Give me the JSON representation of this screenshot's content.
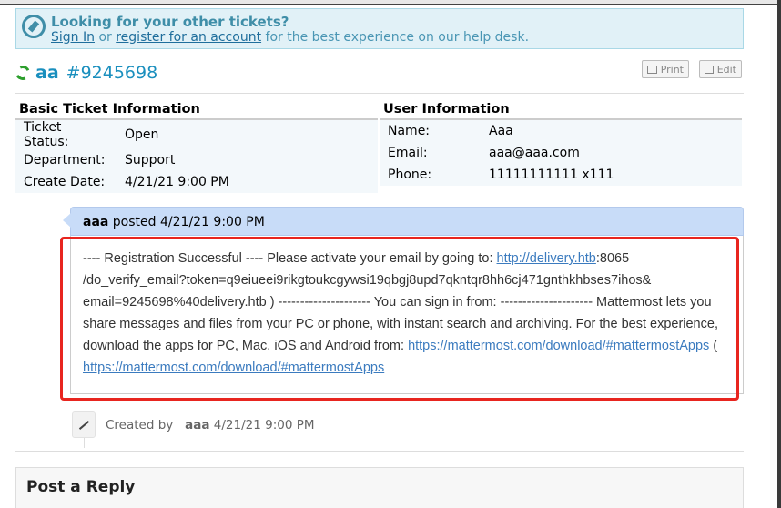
{
  "notice": {
    "title": "Looking for your other tickets?",
    "sign_in": "Sign In",
    "or_text": "or",
    "register": "register for an account",
    "rest": "for the best experience on our help desk."
  },
  "ticket": {
    "subject": "aa",
    "number": "#9245698",
    "print_label": "Print",
    "edit_label": "Edit"
  },
  "basic_info": {
    "heading": "Basic Ticket Information",
    "rows": [
      {
        "label": "Ticket Status:",
        "value": "Open"
      },
      {
        "label": "Department:",
        "value": "Support"
      },
      {
        "label": "Create Date:",
        "value": "4/21/21 9:00 PM"
      }
    ]
  },
  "user_info": {
    "heading": "User Information",
    "rows": [
      {
        "label": "Name:",
        "value": "Aaa"
      },
      {
        "label": "Email:",
        "value": "aaa@aaa.com"
      },
      {
        "label": "Phone:",
        "value": "11111111111 x111"
      }
    ]
  },
  "post": {
    "author": "aaa",
    "posted_text": "posted",
    "time": "4/21/21 9:00 PM",
    "body_1": "---- Registration Successful ---- Please activate your email by going to: ",
    "link_1": "http://delivery.htb",
    "body_2": ":8065 /do_verify_email?token=q9eiueei9rikgtoukcgywsi19qbgj8upd7qkntqr8hh6cj471gnthkhbses7ihos& email=9245698%40delivery.htb ) --------------------- You can sign in from: --------------------- Mattermost lets you share messages and files from your PC or phone, with instant search and archiving. For the best experience, download the apps for PC, Mac, iOS and Android from: ",
    "link_2": "https://mattermost.com/download/#mattermostApps",
    "body_3": " ( ",
    "link_3": "https://mattermost.com/download/#mattermostApps"
  },
  "event": {
    "created_by": "Created by",
    "author": "aaa",
    "time": "4/21/21 9:00 PM"
  },
  "reply": {
    "heading": "Post a Reply"
  },
  "colors": {
    "accent": "#1a8fbe",
    "highlight_box": "#e8251f",
    "notice_bg": "#e1f1f7",
    "post_header_bg": "#c8dcf8"
  },
  "icons": [
    "compass-icon",
    "refresh-icon",
    "print-icon",
    "edit-icon",
    "wand-icon"
  ]
}
